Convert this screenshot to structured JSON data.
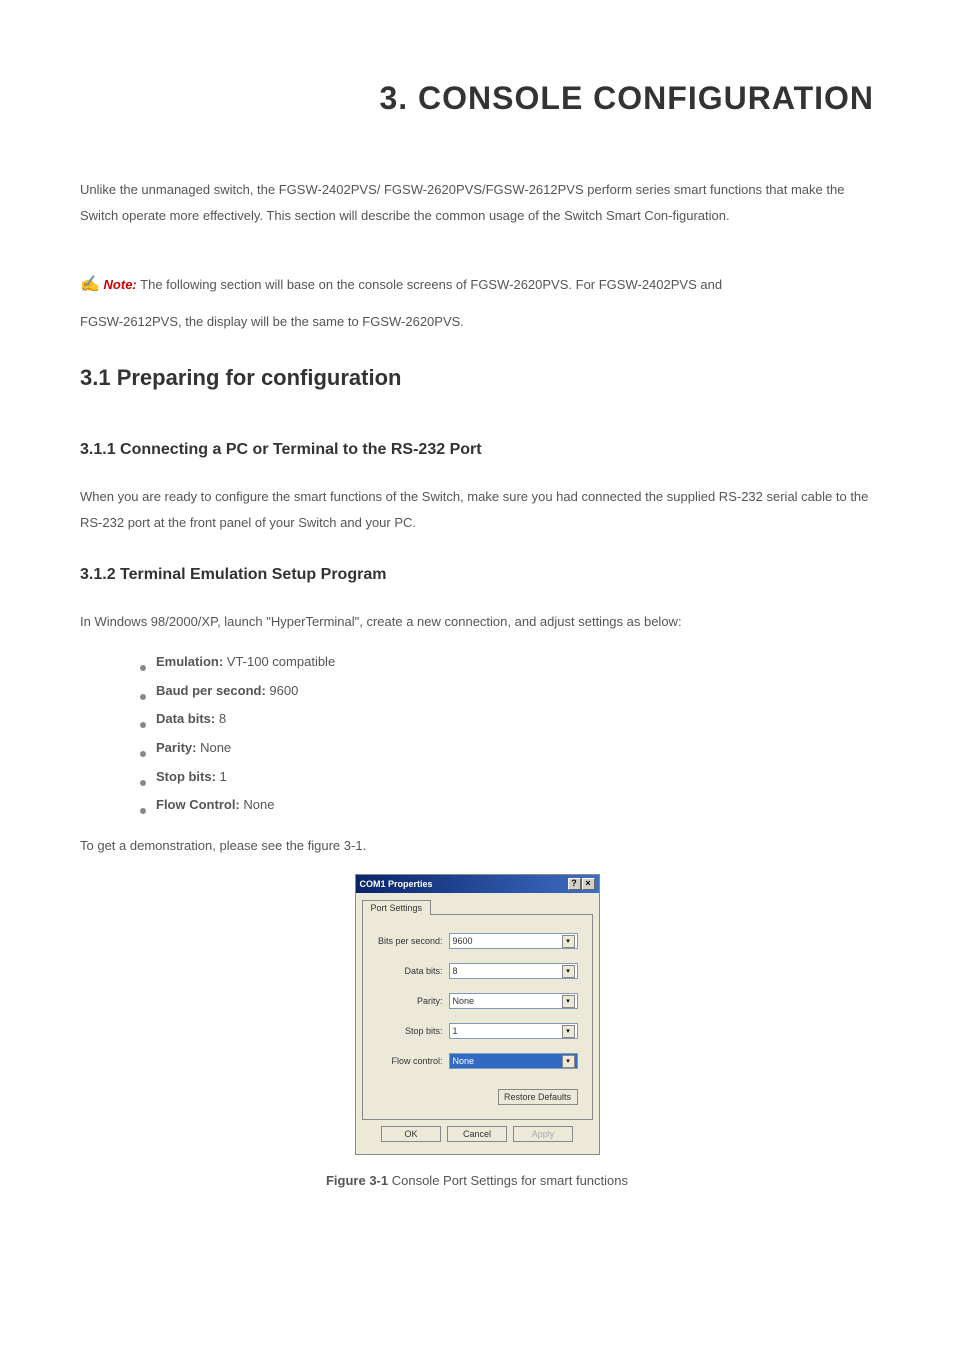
{
  "page": {
    "title": "3. CONSOLE CONFIGURATION",
    "intro": "Unlike the unmanaged switch, the FGSW-2402PVS/ FGSW-2620PVS/FGSW-2612PVS perform series smart functions that make the Switch operate more effectively. This section will describe the common usage of the Switch Smart Con-figuration.",
    "note_icon": "✍",
    "note_label": "Note:",
    "note_text": " The following section will base on the console screens of FGSW-2620PVS. For FGSW-2402PVS and",
    "note_followup": "FGSW-2612PVS, the display will be the same to FGSW-2620PVS.",
    "section_3_1": "3.1 Preparing for configuration",
    "section_3_1_1": "3.1.1 Connecting a PC or Terminal to the RS-232 Port",
    "para_3_1_1": "When you are ready to configure the smart functions of the Switch, make sure you had connected the supplied RS-232 serial cable to the RS-232 port at the front panel of your Switch and your PC.",
    "section_3_1_2": "3.1.2 Terminal Emulation Setup Program",
    "para_3_1_2": "In Windows 98/2000/XP, launch \"HyperTerminal\", create a new connection, and adjust settings as below:",
    "settings": [
      {
        "label": "Emulation:",
        "value": " VT-100 compatible"
      },
      {
        "label": "Baud per second:",
        "value": " 9600"
      },
      {
        "label": "Data bits:",
        "value": " 8"
      },
      {
        "label": "Parity:",
        "value": " None"
      },
      {
        "label": "Stop bits:",
        "value": " 1"
      },
      {
        "label": "Flow Control:",
        "value": " None"
      }
    ],
    "demo_line": "To get a demonstration, please see the figure 3-1."
  },
  "dialog": {
    "title": "COM1 Properties",
    "help_btn": "?",
    "close_btn": "×",
    "tab": "Port Settings",
    "fields": {
      "bps_label": "Bits per second:",
      "bps_value": "9600",
      "databits_label": "Data bits:",
      "databits_value": "8",
      "parity_label": "Parity:",
      "parity_value": "None",
      "stopbits_label": "Stop bits:",
      "stopbits_value": "1",
      "flow_label": "Flow control:",
      "flow_value": "None"
    },
    "restore_btn": "Restore Defaults",
    "ok_btn": "OK",
    "cancel_btn": "Cancel",
    "apply_btn": "Apply"
  },
  "figure": {
    "label": "Figure 3-1",
    "caption": " Console Port Settings for smart functions"
  }
}
